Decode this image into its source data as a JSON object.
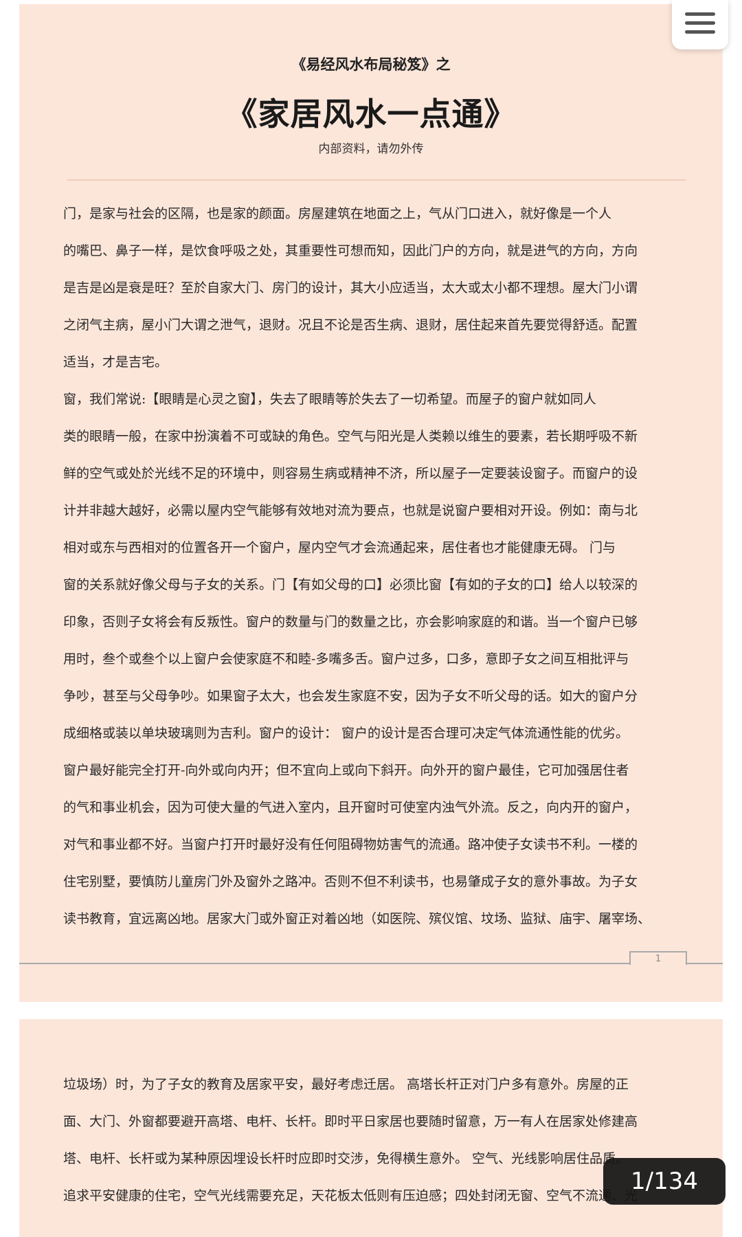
{
  "document": {
    "subtitle": "《易经风水布局秘笈》之",
    "title": "《家居风水一点通》",
    "note": "内部资料，请勿外传"
  },
  "page1": {
    "lines": [
      "    门，是家与社会的区隔，也是家的颜面。房屋建筑在地面之上，气从门口进入，就好像是一个人",
      "的嘴巴、鼻子一样，是饮食呼吸之处，其重要性可想而知，因此门户的方向，就是进气的方向，方向",
      "是吉是凶是衰是旺？至於自家大门、房门的设计，其大小应适当，太大或太小都不理想。屋大门小谓",
      "之闭气主病，屋小门大谓之泄气，退财。况且不论是否生病、退财，居住起来首先要觉得舒适。配置",
      "适当，才是吉宅。",
      "    窗，我们常说:【眼睛是心灵之窗】，失去了眼睛等於失去了一切希望。而屋子的窗户就如同人",
      "类的眼睛一般，在家中扮演着不可或缺的角色。空气与阳光是人类赖以维生的要素，若长期呼吸不新",
      "鲜的空气或处於光线不足的环境中，则容易生病或精神不济，所以屋子一定要装设窗子。而窗户的设",
      "计并非越大越好，必需以屋内空气能够有效地对流为要点，也就是说窗户要相对开设。例如：南与北",
      "相对或东与西相对的位置各开一个窗户，屋内空气才会流通起来，居住者也才能健康无碍。    门与",
      "窗的关系就好像父母与子女的关系。门【有如父母的口】必须比窗【有如的子女的口】给人以较深的",
      "印象，否则子女将会有反叛性。窗户的数量与门的数量之比，亦会影响家庭的和谐。当一个窗户已够",
      "用时，叁个或叁个以上窗户会使家庭不和睦-多嘴多舌。窗户过多，口多，意即子女之间互相批评与",
      "争吵，甚至与父母争吵。如果窗子太大，也会发生家庭不安，因为子女不听父母的话。如大的窗户分",
      "成细格或装以单块玻璃则为吉利。窗户的设计：  窗户的设计是否合理可决定气体流通性能的优劣。",
      "窗户最好能完全打开-向外或向内开；但不宜向上或向下斜开。向外开的窗户最佳，它可加强居住者",
      "的气和事业机会，因为可使大量的气进入室内，且开窗时可使室内浊气外流。反之，向内开的窗户，",
      "对气和事业都不好。当窗户打开时最好没有任何阻碍物妨害气的流通。路冲使子女读书不利。一楼的",
      "住宅别墅，要慎防儿童房门外及窗外之路冲。否则不但不利读书，也易肇成子女的意外事故。为子女",
      "读书教育，宜远离凶地。居家大门或外窗正对着凶地（如医院、殡仪馆、坟场、监狱、庙宇、屠宰场、"
    ],
    "page_number": "1"
  },
  "page2": {
    "lines": [
      "垃圾场）时，为了子女的教育及居家平安，最好考虑迁居。 高塔长杆正对门户多有意外。房屋的正",
      "面、大门、外窗都要避开高塔、电杆、长杆。即时平日家居也要随时留意，万一有人在居家处修建高",
      "塔、电杆、长杆或为某种原因埋设长杆时应即时交涉，免得横生意外。  空气、光线影响居住品质。",
      "追求平安健康的住宅，空气光线需要充足，天花板太低则有压迫感；四处封闭无窗、空气不流通、光"
    ]
  },
  "viewer": {
    "page_counter": "1/134",
    "menu_icon": "hamburger-menu-icon",
    "page_color": "#fce6da"
  }
}
